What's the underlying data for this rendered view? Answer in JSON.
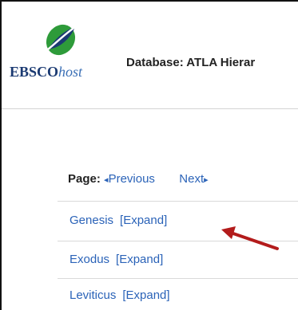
{
  "header": {
    "logo_primary": "EBSCO",
    "logo_secondary": "host",
    "database_title": "Database: ATLA Hierar"
  },
  "pager": {
    "label": "Page:",
    "previous": "Previous",
    "next": "Next",
    "prev_glyph": "◂",
    "next_glyph": "▸"
  },
  "items": [
    {
      "label": "Genesis",
      "expand": "[Expand]"
    },
    {
      "label": "Exodus",
      "expand": "[Expand]"
    },
    {
      "label": "Leviticus",
      "expand": "[Expand]"
    }
  ],
  "colors": {
    "link": "#2b63b8",
    "annotation_arrow": "#b31b1b",
    "logo_green": "#2e9b3a",
    "logo_blue": "#1b3a72"
  }
}
